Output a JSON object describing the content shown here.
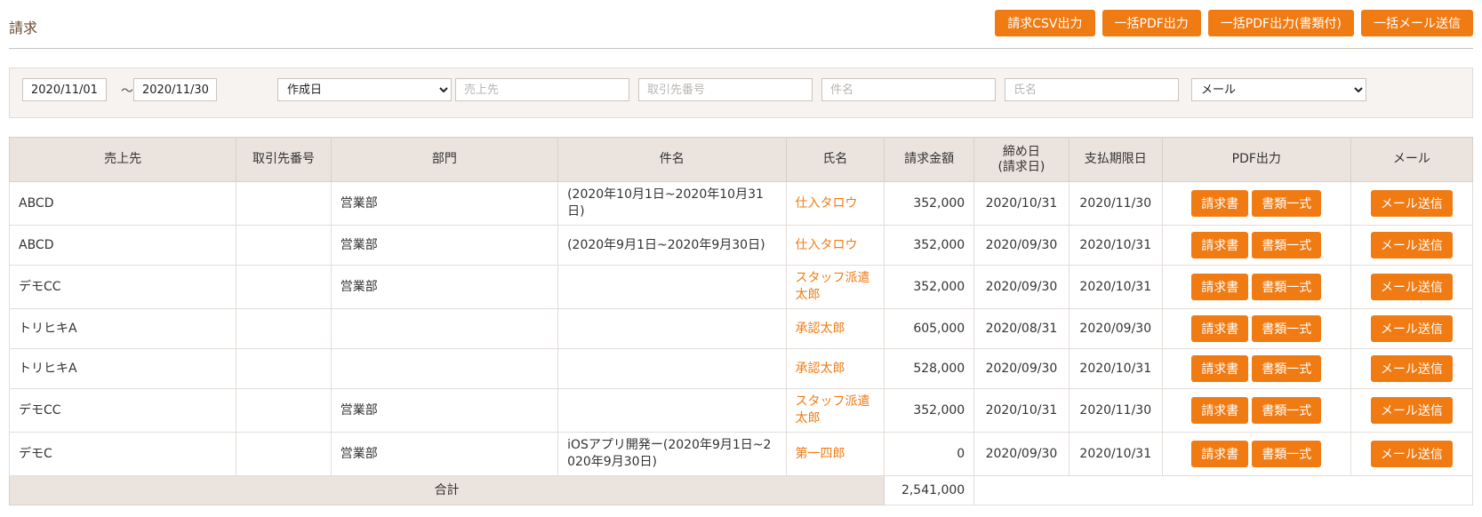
{
  "page": {
    "title": "請求",
    "actions": [
      "請求CSV出力",
      "一括PDF出力",
      "一括PDF出力(書類付)",
      "一括メール送信"
    ]
  },
  "filters": {
    "date_from": "2020/11/01",
    "date_separator": "〜",
    "date_to": "2020/11/30",
    "date_type": "作成日",
    "customer_placeholder": "売上先",
    "partner_no_placeholder": "取引先番号",
    "subject_placeholder": "件名",
    "name_placeholder": "氏名",
    "delivery_method": "メール"
  },
  "table": {
    "headers": {
      "customer": "売上先",
      "partner_no": "取引先番号",
      "department": "部門",
      "subject": "件名",
      "name": "氏名",
      "amount": "請求金額",
      "closing": "締め日",
      "closing_sub": "(請求日)",
      "due": "支払期限日",
      "pdf": "PDF出力",
      "mail": "メール"
    },
    "button_labels": {
      "invoice": "請求書",
      "documents": "書類一式",
      "send_mail": "メール送信"
    },
    "rows": [
      {
        "customer": "ABCD",
        "partner_no": "",
        "department": "営業部",
        "subject_l1": "(2020年10月1日~2020年10月31",
        "subject_l2": "日)",
        "name_l1": "仕入タロウ",
        "name_l2": "",
        "amount": "352,000",
        "closing": "2020/10/31",
        "due": "2020/11/30"
      },
      {
        "customer": "ABCD",
        "partner_no": "",
        "department": "営業部",
        "subject_l1": "(2020年9月1日~2020年9月30日)",
        "subject_l2": "",
        "name_l1": "仕入タロウ",
        "name_l2": "",
        "amount": "352,000",
        "closing": "2020/09/30",
        "due": "2020/10/31"
      },
      {
        "customer": "デモCC",
        "partner_no": "",
        "department": "営業部",
        "subject_l1": "",
        "subject_l2": "",
        "name_l1": "スタッフ派遣",
        "name_l2": "太郎",
        "amount": "352,000",
        "closing": "2020/09/30",
        "due": "2020/10/31"
      },
      {
        "customer": "トリヒキA",
        "partner_no": "",
        "department": "",
        "subject_l1": "",
        "subject_l2": "",
        "name_l1": "承認太郎",
        "name_l2": "",
        "amount": "605,000",
        "closing": "2020/08/31",
        "due": "2020/09/30"
      },
      {
        "customer": "トリヒキA",
        "partner_no": "",
        "department": "",
        "subject_l1": "",
        "subject_l2": "",
        "name_l1": "承認太郎",
        "name_l2": "",
        "amount": "528,000",
        "closing": "2020/09/30",
        "due": "2020/10/31"
      },
      {
        "customer": "デモCC",
        "partner_no": "",
        "department": "営業部",
        "subject_l1": "",
        "subject_l2": "",
        "name_l1": "スタッフ派遣",
        "name_l2": "太郎",
        "amount": "352,000",
        "closing": "2020/10/31",
        "due": "2020/11/30"
      },
      {
        "customer": "デモC",
        "partner_no": "",
        "department": "営業部",
        "subject_l1": "iOSアプリ開発ー(2020年9月1日~2",
        "subject_l2": "020年9月30日)",
        "name_l1": "第一四郎",
        "name_l2": "",
        "amount": "0",
        "closing": "2020/09/30",
        "due": "2020/10/31"
      }
    ],
    "total_label": "合計",
    "total_amount": "2,541,000"
  }
}
